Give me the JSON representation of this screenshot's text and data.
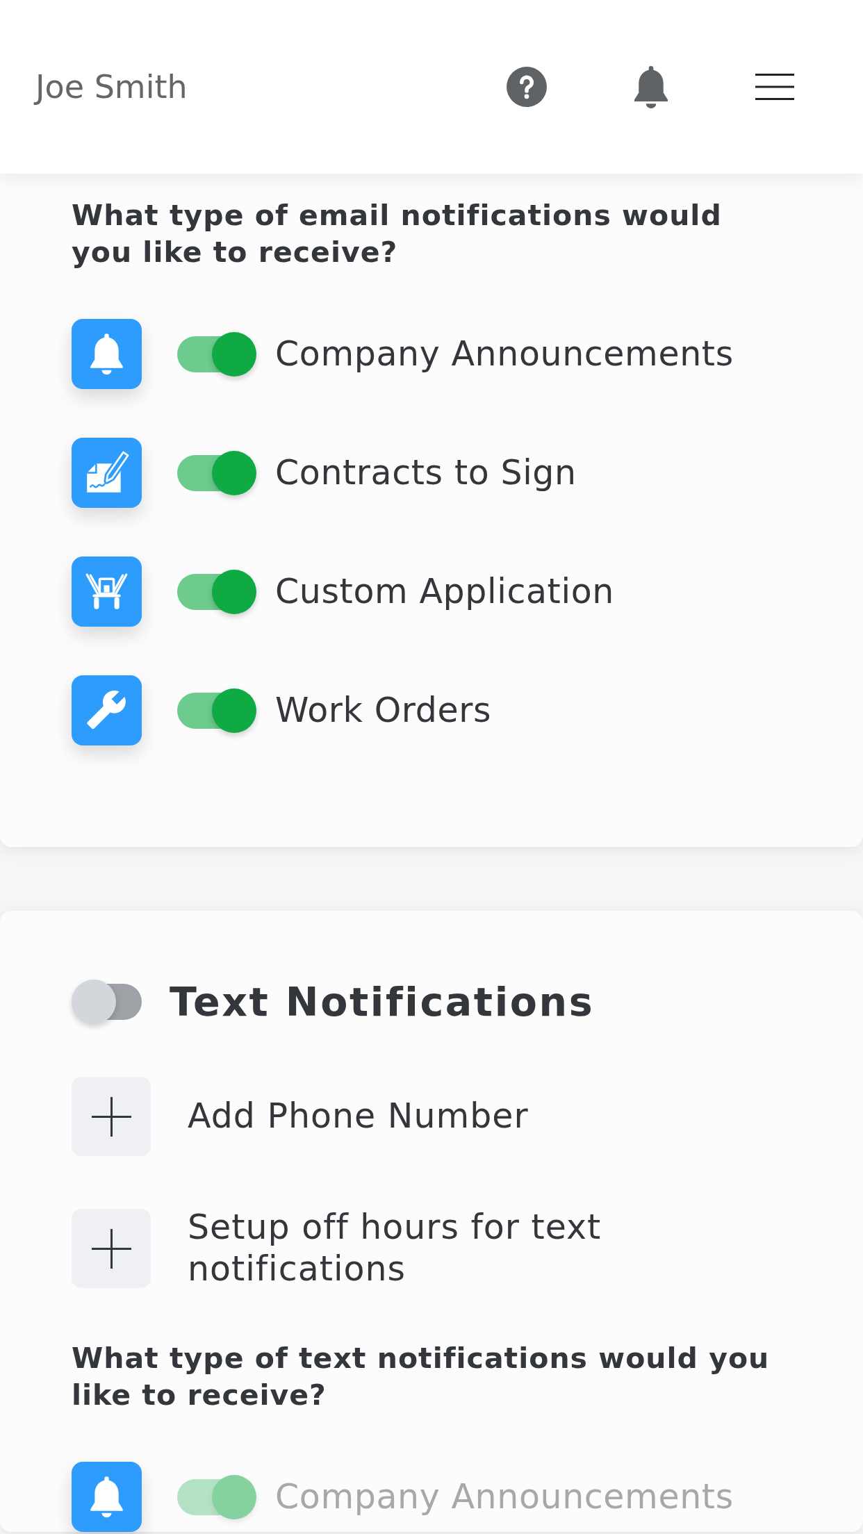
{
  "header": {
    "user_name": "Joe Smith"
  },
  "email_notifications": {
    "question": "What type of email notifications would you like to receive?",
    "items": [
      {
        "label": "Company Announcements",
        "on": true,
        "disabled": false
      },
      {
        "label": "Contracts to Sign",
        "on": true,
        "disabled": false
      },
      {
        "label": "Custom Application",
        "on": true,
        "disabled": false
      },
      {
        "label": "Work Orders",
        "on": true,
        "disabled": false
      }
    ]
  },
  "text_notifications": {
    "title": "Text Notifications",
    "on": false,
    "actions": [
      {
        "label": "Add Phone Number"
      },
      {
        "label": "Setup off hours for text notifications"
      }
    ],
    "question": "What type of text notifications would you like to receive?",
    "items": [
      {
        "label": "Company Announcements",
        "on": true,
        "disabled": true
      }
    ]
  }
}
